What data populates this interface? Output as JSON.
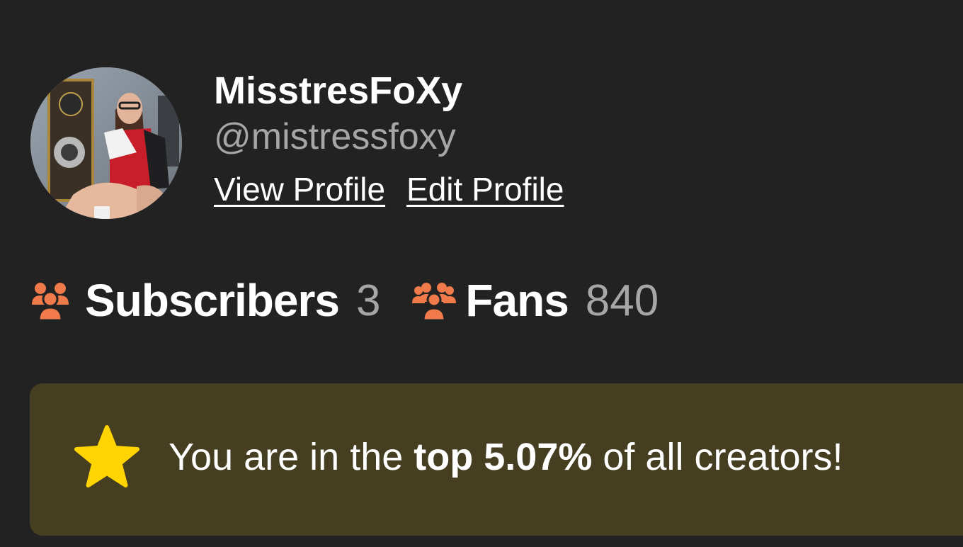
{
  "profile": {
    "display_name": "MisstresFoXy",
    "handle": "@mistressfoxy",
    "view_profile_label": "View Profile",
    "edit_profile_label": "Edit Profile",
    "avatar_icon": "user-avatar-photo"
  },
  "stats": {
    "subscribers_label": "Subscribers",
    "subscribers_value": "3",
    "fans_label": "Fans",
    "fans_value": "840",
    "icon": "group-people-icon",
    "icon_color": "#f07a4a"
  },
  "banner": {
    "text_prefix": "You are in the",
    "text_highlight": "top 5.07%",
    "text_suffix": "of all creators!",
    "icon": "star-icon",
    "star_color": "#ffd400",
    "background": "#453e20"
  }
}
